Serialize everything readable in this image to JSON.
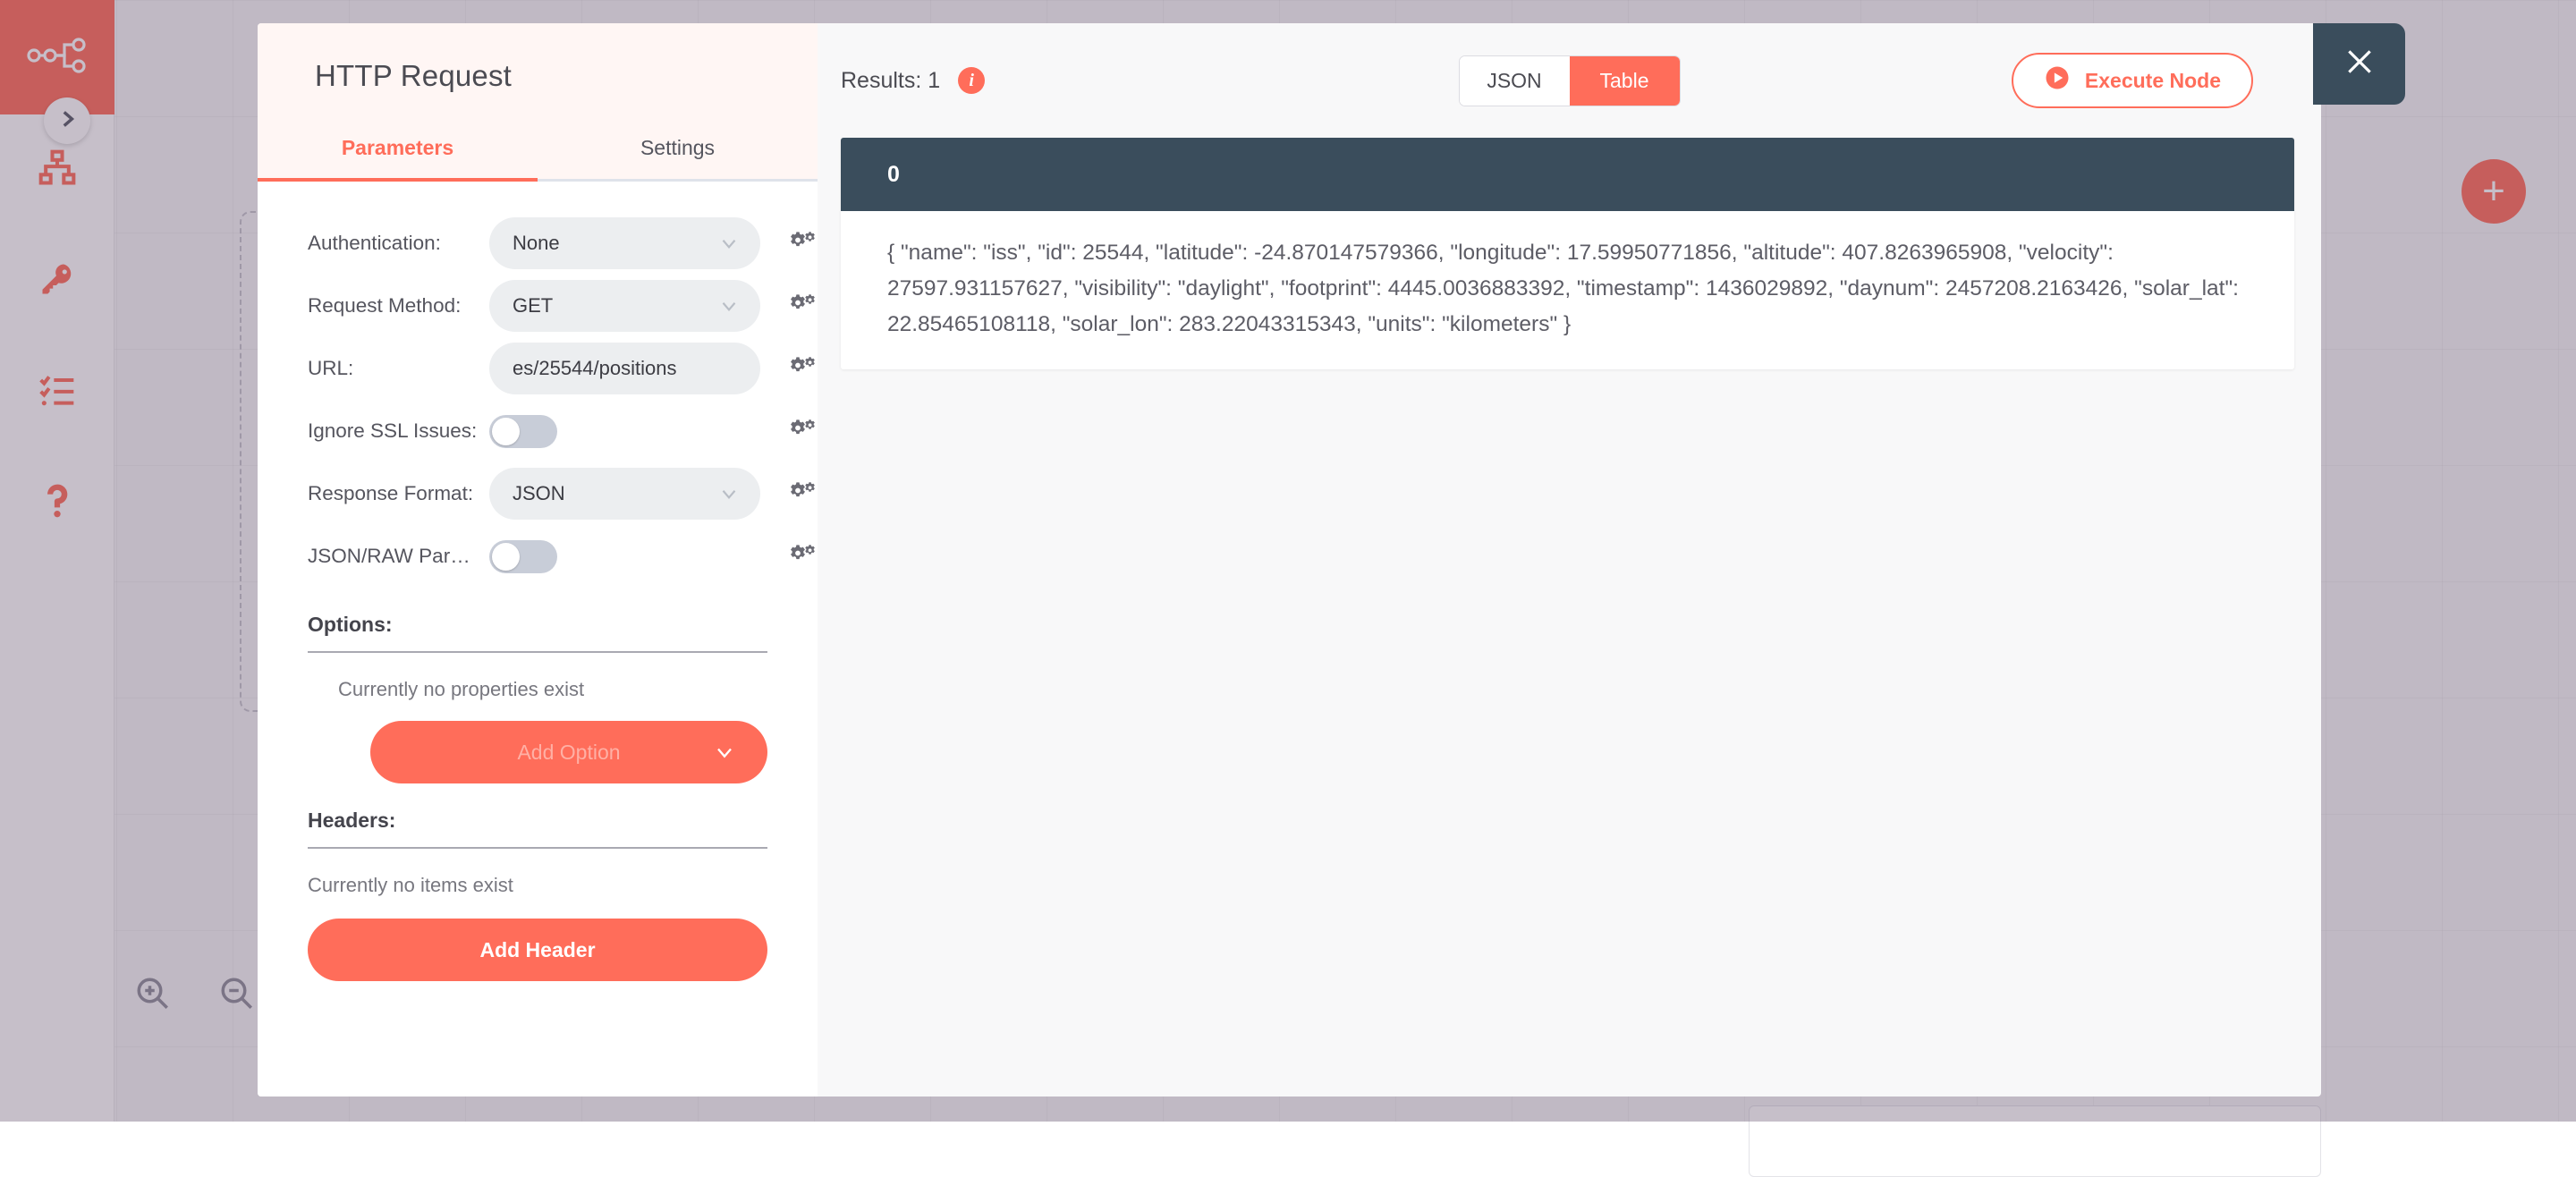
{
  "colors": {
    "accent": "#ff6d5a",
    "dark_panel": "#3a4d5c",
    "header_bg": "#fff6f4",
    "field_bg": "#eceef0"
  },
  "sidebar": {
    "items": [
      {
        "icon": "workflow-logo-icon"
      },
      {
        "icon": "sitemap-icon"
      },
      {
        "icon": "key-icon"
      },
      {
        "icon": "checklist-icon"
      },
      {
        "icon": "question-mark-icon"
      }
    ],
    "expand_icon": "chevron-right-icon"
  },
  "canvas": {
    "add_node_label": "+",
    "zoom_in_icon": "zoom-in-icon",
    "zoom_out_icon": "zoom-out-icon"
  },
  "node_detail_view": {
    "title": "HTTP Request",
    "tabs": [
      {
        "label": "Parameters",
        "active": true
      },
      {
        "label": "Settings",
        "active": false
      }
    ],
    "parameters": [
      {
        "label": "Authentication:",
        "type": "select",
        "value": "None",
        "name": "authentication"
      },
      {
        "label": "Request Method:",
        "type": "select",
        "value": "GET",
        "name": "request-method"
      },
      {
        "label": "URL:",
        "type": "text",
        "value": "es/25544/positions",
        "name": "url"
      },
      {
        "label": "Ignore SSL Issues:",
        "type": "toggle",
        "value": "off",
        "name": "ignore-ssl-issues"
      },
      {
        "label": "Response Format:",
        "type": "select",
        "value": "JSON",
        "name": "response-format"
      },
      {
        "label": "JSON/RAW Parame...",
        "type": "toggle",
        "value": "off",
        "name": "json-raw-parameters"
      }
    ],
    "options_section": {
      "title": "Options:",
      "empty_text": "Currently no properties exist",
      "button_label": "Add Option"
    },
    "headers_section": {
      "title": "Headers:",
      "empty_text": "Currently no items exist",
      "button_label": "Add Header"
    },
    "close_icon": "close-icon"
  },
  "output": {
    "results_label": "Results: 1",
    "info_icon": "info-icon",
    "view_modes": [
      {
        "label": "JSON",
        "active": false
      },
      {
        "label": "Table",
        "active": true
      }
    ],
    "execute_button": {
      "label": "Execute Node",
      "icon": "play-circle-icon"
    },
    "table": {
      "column_header": "0",
      "cell_value": "{ \"name\": \"iss\", \"id\": 25544, \"latitude\": -24.870147579366, \"longitude\": 17.59950771856, \"altitude\": 407.8263965908, \"velocity\": 27597.931157627, \"visibility\": \"daylight\", \"footprint\": 4445.0036883392, \"timestamp\": 1436029892, \"daynum\": 2457208.2163426, \"solar_lat\": 22.85465108118, \"solar_lon\": 283.22043315343, \"units\": \"kilometers\" }"
    }
  }
}
